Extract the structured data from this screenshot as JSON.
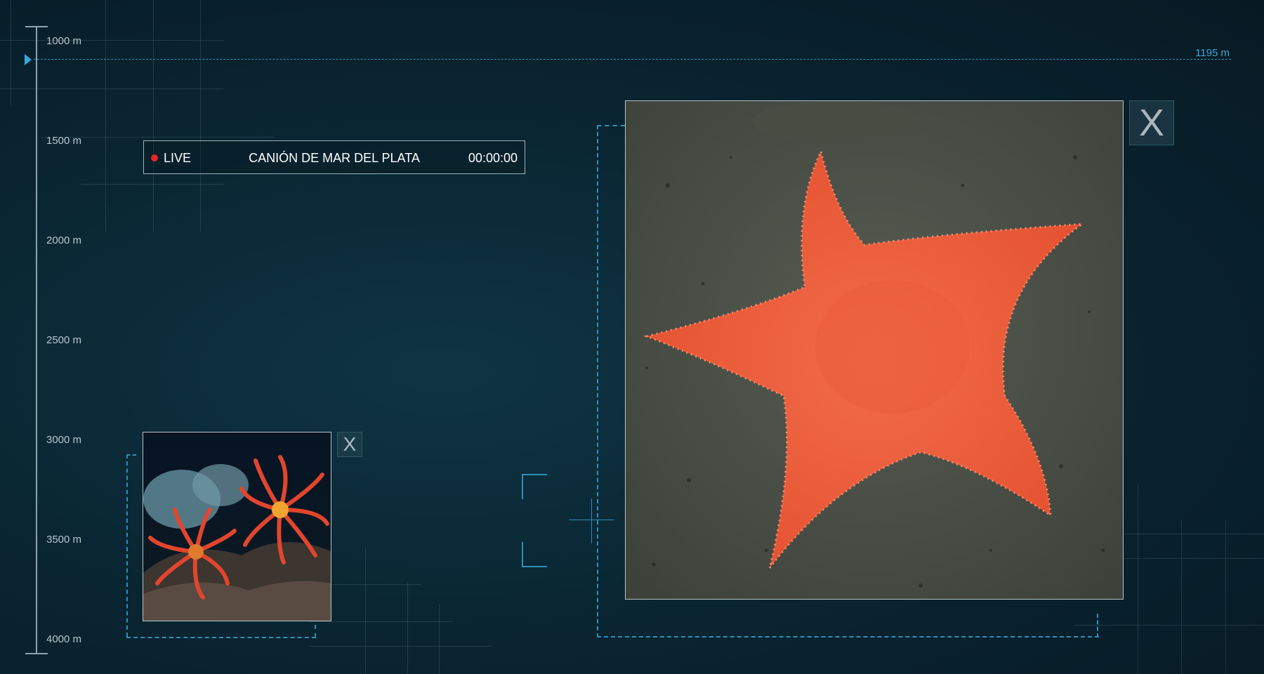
{
  "depth_scale": {
    "labels": [
      "1000 m",
      "1500 m",
      "2000 m",
      "2500 m",
      "3000 m",
      "3500 m",
      "4000 m"
    ],
    "current_depth": "1195 m"
  },
  "live_bar": {
    "status": "LIVE",
    "location": "CANIÓN DE MAR DEL PLATA",
    "timer": "00:00:00"
  },
  "thumbnail": {
    "close_label": "X"
  },
  "main_view": {
    "close_label": "X"
  },
  "colors": {
    "accent": "#2e8fb8",
    "live_dot": "#e8262b",
    "background": "#0a2633"
  }
}
